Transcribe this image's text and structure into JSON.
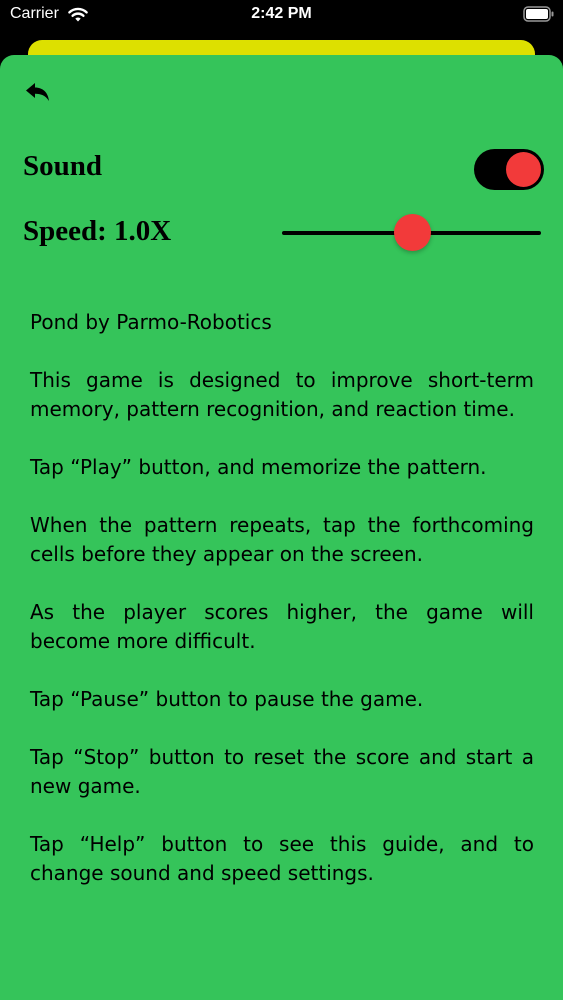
{
  "status_bar": {
    "carrier": "Carrier",
    "time": "2:42 PM",
    "wifi_icon": "wifi-icon",
    "battery_icon": "battery-icon"
  },
  "colors": {
    "sheet_background": "#35c45a",
    "underlay_sheet": "#dde000",
    "accent": "#f23a3a",
    "text": "#000000"
  },
  "toolbar": {
    "back_icon": "back-arrow-icon"
  },
  "settings": {
    "sound_label": "Sound",
    "sound_enabled": true,
    "speed_label": "Speed: 1.0X",
    "speed_slider_fraction": 0.5
  },
  "help": {
    "paragraphs": [
      "Pond by Parmo-Robotics",
      "This game is designed to improve short-term memory, pattern recognition, and reaction time.",
      "Tap “Play” button, and memorize the pattern.",
      "When the pattern repeats, tap the forthcoming cells before they appear on the screen.",
      "As the player scores higher, the game will become more difficult.",
      "Tap “Pause” button to pause the game.",
      "Tap “Stop” button to reset the score and start a new game.",
      "Tap “Help” button to see this guide, and to change sound and speed settings."
    ]
  }
}
